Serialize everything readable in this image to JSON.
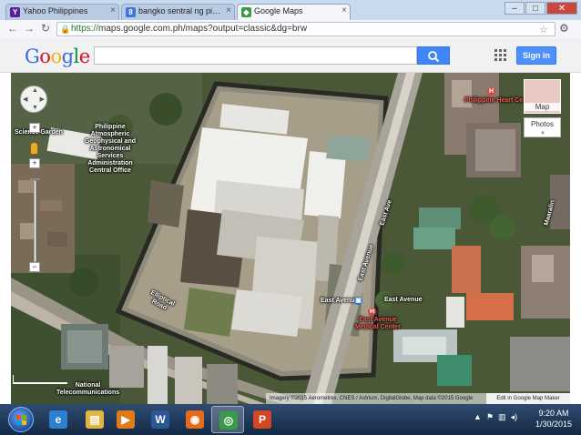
{
  "browser": {
    "tabs": [
      {
        "label": "Yahoo Philippines",
        "icon": "yahoo-favicon",
        "color": "#5f1b9e"
      },
      {
        "label": "bangko sentral ng pilipinas",
        "icon": "google-search-favicon",
        "color": "#3f74d8"
      },
      {
        "label": "Google Maps",
        "icon": "google-maps-favicon",
        "color": "#3b9a4a"
      }
    ],
    "url_scheme": "https://",
    "url_rest": "maps.google.com.ph/maps?output=classic&dg=brw",
    "window_buttons": {
      "minimize": "–",
      "maximize": "□",
      "close": "✕"
    }
  },
  "google": {
    "logo_letters": [
      {
        "ch": "G",
        "color": "#3369e8"
      },
      {
        "ch": "o",
        "color": "#d50f25"
      },
      {
        "ch": "o",
        "color": "#eeb211"
      },
      {
        "ch": "g",
        "color": "#3369e8"
      },
      {
        "ch": "l",
        "color": "#009925"
      },
      {
        "ch": "e",
        "color": "#d50f25"
      }
    ],
    "search_value": "",
    "signin_label": "Sign in"
  },
  "map": {
    "labels": {
      "pagasa": "Philippine\nAtmospheric\nGeophysical and\nAstronomical\nServices\nAdministration\nCentral Office",
      "science_garden": "Science Garden",
      "elliptical": "Elliptical\nRoad",
      "east_avenue_1": "East Ave",
      "east_avenue_2": "East Avenue",
      "east_avenue_3": "East Avenue",
      "east_avenue_medical": "East Avenue\nMedical Center",
      "heart_center": "Philippine Heart Center",
      "maaralin": "Maaralin",
      "national_telecom": "National\nTelecommunications"
    },
    "map_type_label": "Map",
    "photos_label": "Photos",
    "attribution": "Imagery ©2015 Aerometrex, CNES / Astrium, DigitalGlobe, Map data ©2015 Google",
    "map_maker": "Edit in Google Map Maker"
  },
  "taskbar": {
    "apps": [
      {
        "name": "internet-explorer",
        "glyph": "e",
        "color": "#2d7fd3"
      },
      {
        "name": "file-explorer",
        "glyph": "▤",
        "color": "#e2b441"
      },
      {
        "name": "media-player",
        "glyph": "▶",
        "color": "#e07b1a"
      },
      {
        "name": "word",
        "glyph": "W",
        "color": "#2b5797"
      },
      {
        "name": "firefox",
        "glyph": "◉",
        "color": "#e66a1c"
      },
      {
        "name": "chrome",
        "glyph": "◎",
        "color": "#3b9a4a"
      },
      {
        "name": "powerpoint",
        "glyph": "P",
        "color": "#d24726"
      }
    ],
    "time": "9:20 AM",
    "date": "1/30/2015"
  }
}
